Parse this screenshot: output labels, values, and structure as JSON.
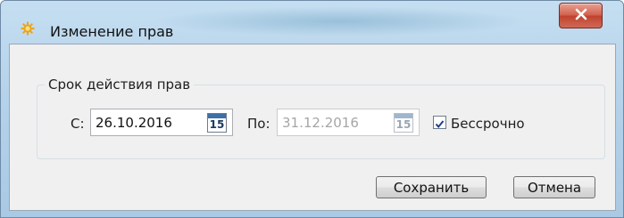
{
  "window": {
    "title": "Изменение прав",
    "icon": "sun-gear-icon",
    "close_icon": "close-icon"
  },
  "validity_group": {
    "legend": "Срок действия прав",
    "from_label": "С:",
    "from_value": "26.10.2016",
    "from_enabled": true,
    "to_label": "По:",
    "to_value": "31.12.2016",
    "to_enabled": false,
    "calendar_icon": "calendar-icon",
    "calendar_day": "15",
    "indefinite_label": "Бессрочно",
    "indefinite_checked": true
  },
  "buttons": {
    "save_label": "Сохранить",
    "cancel_label": "Отмена"
  },
  "colors": {
    "titlebar": "#b4d2ea",
    "close_button": "#c0422f",
    "dialog_background": "#f0f0f0"
  }
}
